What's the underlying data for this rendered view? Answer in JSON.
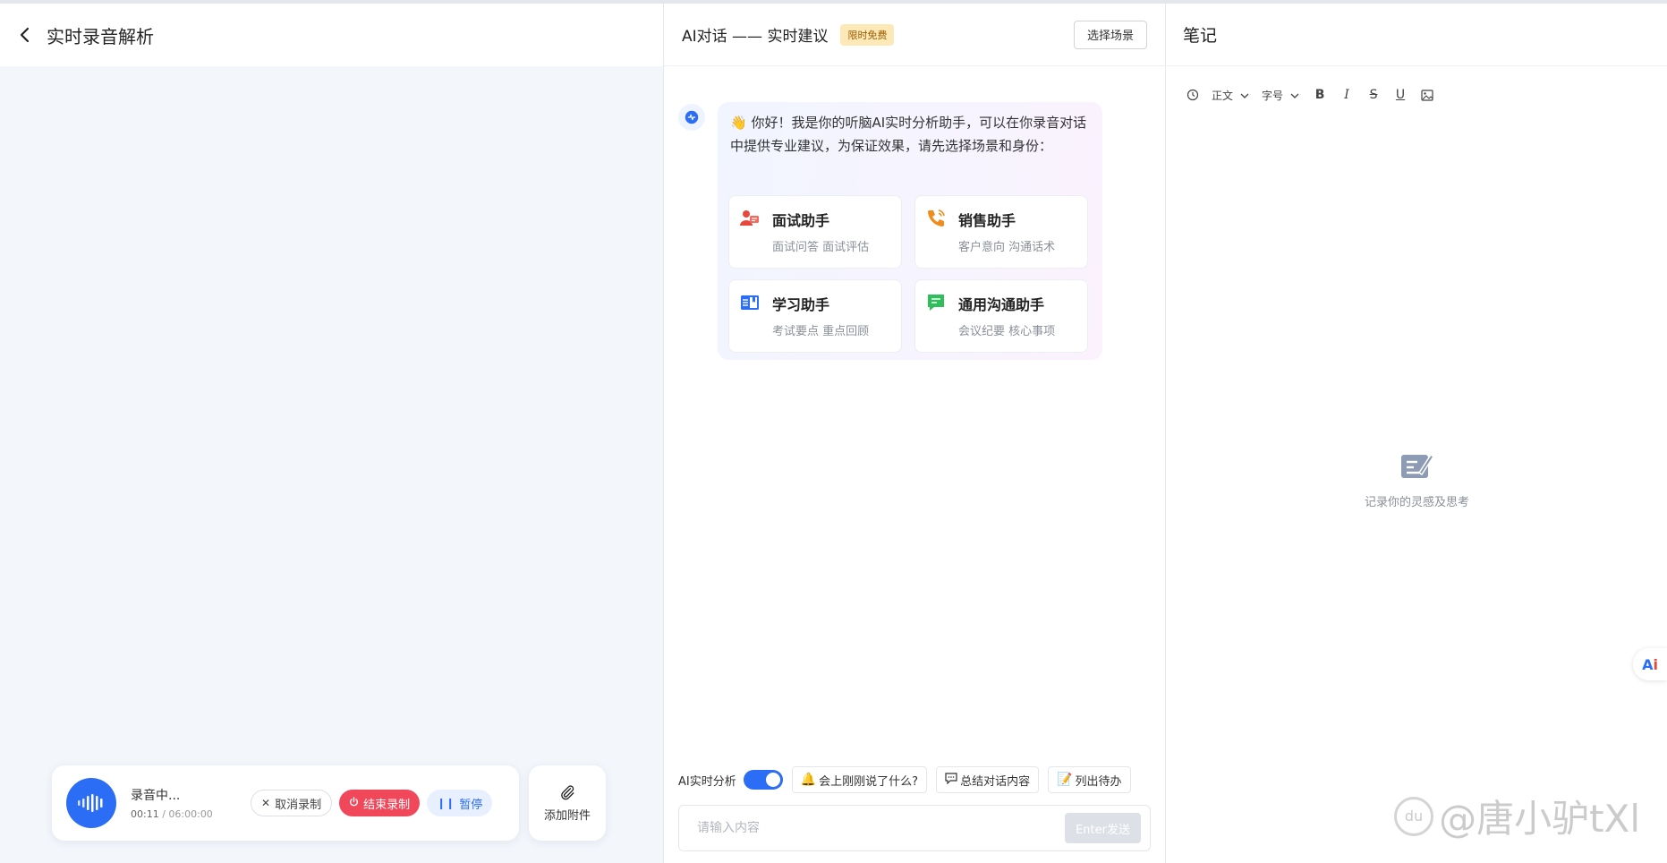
{
  "left": {
    "title": "实时录音解析",
    "recorder": {
      "status": "录音中...",
      "elapsed": "00:11",
      "total": "06:00:00",
      "cancel_label": "取消录制",
      "end_label": "结束录制",
      "pause_label": "暂停"
    },
    "attach_label": "添加附件"
  },
  "middle": {
    "title": "AI对话 —— 实时建议",
    "badge": "限时免费",
    "scene_button": "选择场景",
    "greeting": "你好！我是你的听脑AI实时分析助手，可以在你录音对话中提供专业建议，为保证效果，请先选择场景和身份：",
    "assistants": [
      {
        "title": "面试助手",
        "subtitle": "面试问答 面试评估",
        "icon": "interview-icon",
        "color": "#e8483c"
      },
      {
        "title": "销售助手",
        "subtitle": "客户意向 沟通话术",
        "icon": "phone-icon",
        "color": "#f08c1a"
      },
      {
        "title": "学习助手",
        "subtitle": "考试要点 重点回顾",
        "icon": "book-icon",
        "color": "#2b6df5"
      },
      {
        "title": "通用沟通助手",
        "subtitle": "会议纪要 核心事项",
        "icon": "chat-icon",
        "color": "#2fbf5a"
      }
    ],
    "ai_analysis_label": "AI实时分析",
    "ai_analysis_on": true,
    "quick_prompts": [
      {
        "icon": "bell-icon",
        "label": "会上刚刚说了什么?"
      },
      {
        "icon": "message-icon",
        "label": "总结对话内容"
      },
      {
        "icon": "list-icon",
        "label": "列出待办"
      }
    ],
    "input_placeholder": "请输入内容",
    "send_label": "Enter发送"
  },
  "right": {
    "title": "笔记",
    "toolbar": {
      "paragraph_style": "正文",
      "font_size": "字号",
      "bold": "B",
      "italic": "I",
      "strike": "S",
      "underline": "U"
    },
    "empty_text": "记录你的灵感及思考",
    "ai_button": "Ai"
  },
  "watermark": "@唐小驴tXl",
  "colors": {
    "accent": "#2b6df5",
    "danger": "#f0475a",
    "badge_bg": "#fde9b8"
  }
}
